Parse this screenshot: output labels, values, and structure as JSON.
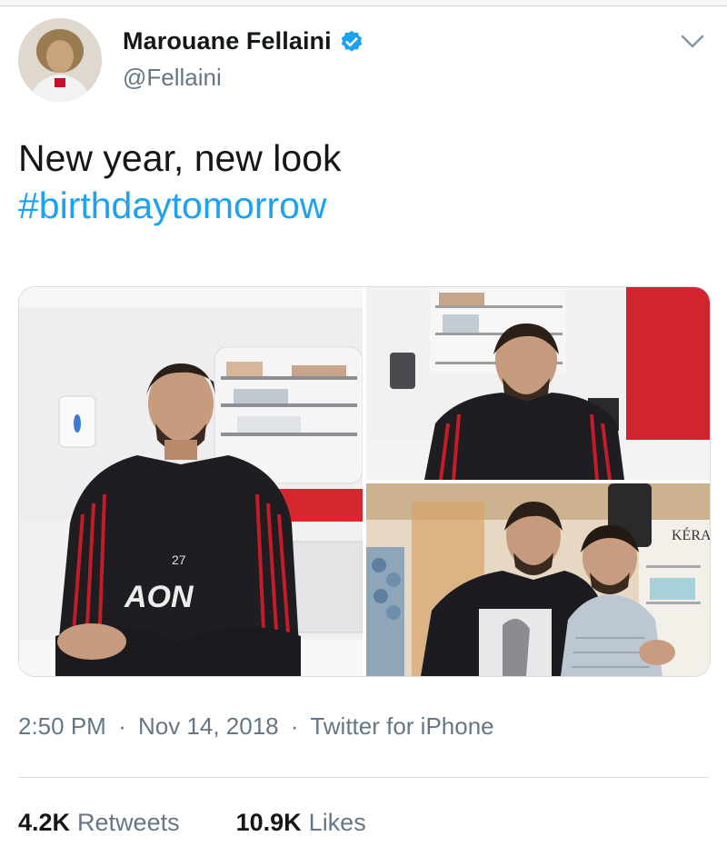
{
  "author": {
    "display_name": "Marouane Fellaini",
    "handle": "@Fellaini",
    "verified_icon": "verified-badge-icon"
  },
  "tweet": {
    "text": "New year, new look",
    "hashtag": "#birthdaytomorrow"
  },
  "media": {
    "photos": [
      "photo-1",
      "photo-2",
      "photo-3"
    ],
    "jersey_number": "27",
    "sponsor_text": "AON",
    "sign_text": "KÉRA"
  },
  "meta": {
    "time": "2:50 PM",
    "date": "Nov 14, 2018",
    "source": "Twitter for iPhone",
    "separator": "·"
  },
  "stats": {
    "retweets_count": "4.2K",
    "retweets_label": "Retweets",
    "likes_count": "10.9K",
    "likes_label": "Likes"
  },
  "colors": {
    "link": "#1da1f2",
    "secondary_text": "#657786",
    "primary_text": "#14171a"
  }
}
